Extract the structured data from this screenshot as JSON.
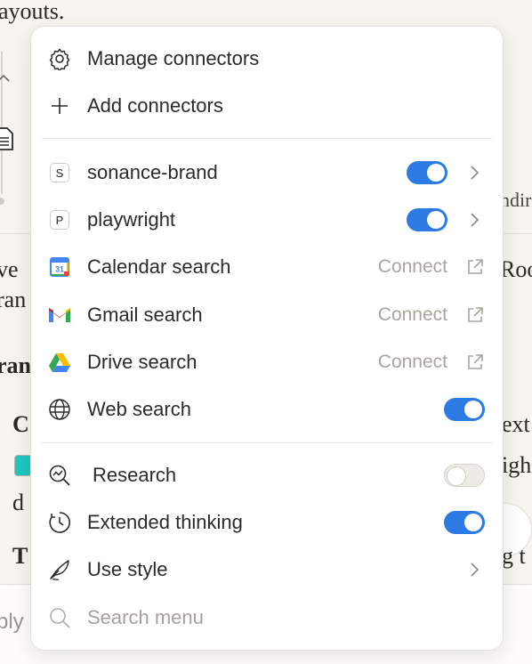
{
  "background": {
    "top_text": "ayouts.",
    "right_fragment_1": "ndir",
    "left_fragment_1": "ve",
    "left_fragment_2": "ran",
    "right_fragment_2": "Roo",
    "left_fragment_3": "ran",
    "left_fragment_4": "C",
    "right_fragment_3": "ext",
    "right_fragment_4": "igh",
    "left_fragment_5": "d",
    "left_fragment_6": "T",
    "right_fragment_5": "g t",
    "footer_fragment": "ply"
  },
  "menu": {
    "manage_connectors": "Manage connectors",
    "add_connectors": "Add connectors",
    "connectors": [
      {
        "name": "sonance-brand",
        "badge": "S",
        "enabled": true
      },
      {
        "name": "playwright",
        "badge": "P",
        "enabled": true
      }
    ],
    "integrations": [
      {
        "name": "Calendar search",
        "action": "Connect",
        "icon": "google-calendar-icon"
      },
      {
        "name": "Gmail search",
        "action": "Connect",
        "icon": "gmail-icon"
      },
      {
        "name": "Drive search",
        "action": "Connect",
        "icon": "google-drive-icon"
      }
    ],
    "calendar_badge_number": "31",
    "web_search": {
      "label": "Web search",
      "enabled": true
    },
    "research": {
      "label": "Research",
      "enabled": false
    },
    "extended_thinking": {
      "label": "Extended thinking",
      "enabled": true
    },
    "use_style": "Use style",
    "search_placeholder": "Search menu"
  },
  "colors": {
    "toggle_on": "#2c7be5",
    "muted_text": "#a6a29a"
  }
}
